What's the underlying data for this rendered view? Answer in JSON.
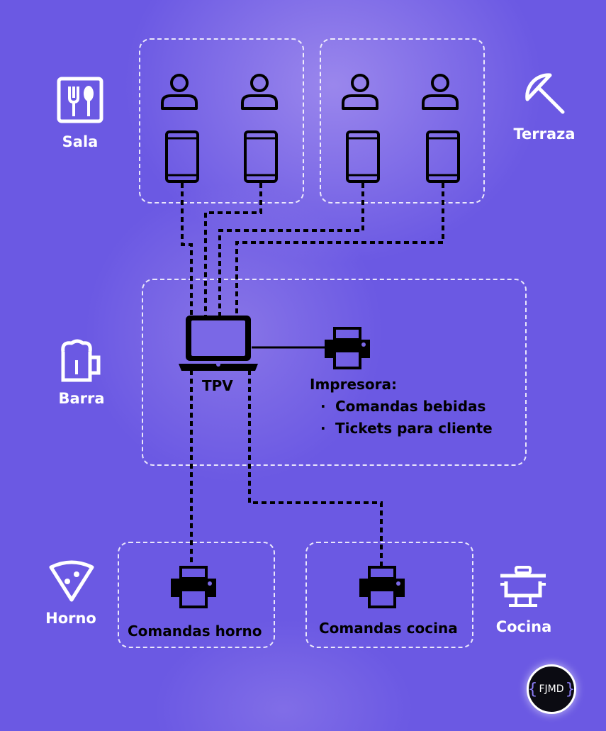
{
  "areas": {
    "sala": "Sala",
    "terraza": "Terraza",
    "barra": "Barra",
    "horno": "Horno",
    "cocina": "Cocina"
  },
  "tpv_label": "TPV",
  "printer": {
    "title": "Impresora:",
    "items": [
      "Comandas bebidas",
      "Tickets para cliente"
    ],
    "bullet": "·"
  },
  "horno_printer_label": "Comandas horno",
  "cocina_printer_label": "Comandas cocina",
  "logo": {
    "left": "{",
    "text": "FJMD",
    "right": "}"
  },
  "icons": {
    "sala": "fork-knife-icon",
    "terraza": "umbrella-icon",
    "barra": "beer-mug-icon",
    "horno": "pizza-slice-icon",
    "cocina": "cooking-pot-icon",
    "waiter": "user-icon",
    "tablet": "tablet-icon",
    "laptop": "laptop-icon",
    "printer": "printer-icon"
  }
}
